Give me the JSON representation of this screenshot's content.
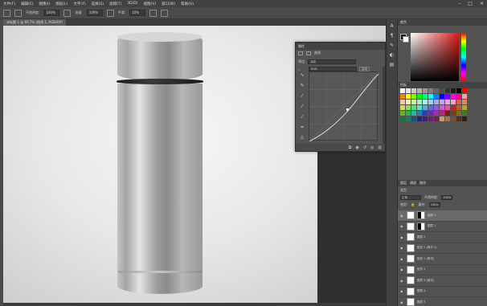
{
  "menu": [
    "文件(F)",
    "编辑(E)",
    "图像(I)",
    "图层(L)",
    "文字(Y)",
    "选择(S)",
    "滤镜(T)",
    "3D(D)",
    "视图(V)",
    "窗口(W)",
    "帮助(H)"
  ],
  "window_controls": [
    "–",
    "□",
    "✕"
  ],
  "options": {
    "size_label": "不透明度:",
    "opacity": "100%",
    "flow_label": "流量:",
    "flow": "100%",
    "smooth_label": "平滑:",
    "smooth": "10%"
  },
  "document_tab": "未标题-1 @ 66.7% (曲线 1, RGB/8#)",
  "curves_panel": {
    "title": "属性",
    "tab": "曲线",
    "preset_label": "预设:",
    "preset_value": "自定",
    "channel": "RGB",
    "auto_label": "自动"
  },
  "right_panel": {
    "color_tab": "颜色",
    "swatch_tab": "色板",
    "layers_tab": "图层",
    "channels_tab": "通道",
    "paths_tab": "路径",
    "kind_label": "类型",
    "mode": "正常",
    "opacity_label": "不透明度:",
    "opacity": "100%",
    "lock_label": "锁定:",
    "fill_label": "填充:",
    "fill": "100%"
  },
  "layers": [
    {
      "name": "曲线 1",
      "selected": true,
      "mask": true
    },
    {
      "name": "图层 1",
      "selected": false,
      "mask": true
    },
    {
      "name": "图层 2",
      "selected": false,
      "mask": false
    },
    {
      "name": "矩形 1 (拷贝 2)",
      "selected": false,
      "mask": false
    },
    {
      "name": "矩形 1 (拷贝)",
      "selected": false,
      "mask": false
    },
    {
      "name": "矩形 1",
      "selected": false,
      "mask": false
    },
    {
      "name": "图层 4 (拷贝)",
      "selected": false,
      "mask": false
    },
    {
      "name": "图层 4",
      "selected": false,
      "mask": false
    },
    {
      "name": "图层 3",
      "selected": false,
      "mask": false
    }
  ],
  "swatch_colors": [
    "#ffffff",
    "#e6e6e6",
    "#cccccc",
    "#b3b3b3",
    "#999999",
    "#808080",
    "#666666",
    "#4d4d4d",
    "#333333",
    "#1a1a1a",
    "#000000",
    "#ff0000",
    "#ff7f00",
    "#ffff00",
    "#7fff00",
    "#00ff00",
    "#00ff7f",
    "#00ffff",
    "#007fff",
    "#0000ff",
    "#7f00ff",
    "#ff00ff",
    "#ff007f",
    "#f5a3a3",
    "#f5c7a3",
    "#f5f0a3",
    "#c7f5a3",
    "#a3f5b1",
    "#a3f5e6",
    "#a3cff5",
    "#a3acf5",
    "#c2a3f5",
    "#f0a3f5",
    "#f5a3c8",
    "#e05a5a",
    "#e08a5a",
    "#e0d25a",
    "#8ae05a",
    "#5ae07a",
    "#5ae0cc",
    "#5aa8e0",
    "#5a6ee0",
    "#915ae0",
    "#d15ae0",
    "#e05a9c",
    "#b52a2a",
    "#b55f2a",
    "#b5a72a",
    "#5fb52a",
    "#2ab54d",
    "#2ab5a0",
    "#2a7db5",
    "#2a3fb5",
    "#6a2ab5",
    "#a72ab5",
    "#b52a72",
    "#7a1a1a",
    "#7a401a",
    "#7a701a",
    "#407a1a",
    "#1a7a33",
    "#1a7a6b",
    "#1a537a",
    "#1a2a7a",
    "#471a7a",
    "#701a7a",
    "#7a1a4c",
    "#c8a070",
    "#a07850",
    "#785038",
    "#503020",
    "#302010"
  ]
}
